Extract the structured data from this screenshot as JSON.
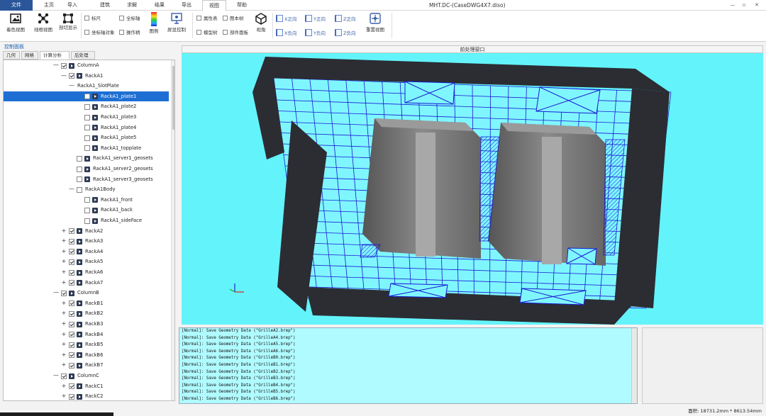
{
  "menubar": {
    "file": "文件",
    "items": [
      "主页",
      "导入",
      "建筑",
      "求解",
      "结果",
      "导出",
      "视图",
      "帮助"
    ],
    "active": "视图",
    "window_title": "MHT.DC-(CaseDWG4X7.diso)",
    "controls": {
      "minimize": "—",
      "restore": "▫",
      "close": "✕"
    }
  },
  "ribbon": {
    "view_btn1": "着色视图",
    "view_btn2": "线框视图",
    "view_btn3": "剖切显示",
    "chk_ruler": "标尺",
    "chk_global_axis": "全标轴",
    "chk_axis_object": "坐标轴对象",
    "chk_handle": "操作柄",
    "legend": "图例",
    "screen_ctrl": "屏显控制",
    "chk_property": "属性表",
    "chk_panel": "图本树",
    "chk_model_tree": "模型树",
    "chk_component": "部件面板",
    "perspective": "视角",
    "xpos": "X正向",
    "ypos": "Y正向",
    "zpos": "Z正向",
    "xneg": "X负向",
    "yneg": "Y负向",
    "zneg": "Z负向",
    "reset": "重置视图"
  },
  "panel": {
    "title": "控制面板",
    "tabs": [
      "几何",
      "网格",
      "计算分析",
      "后处理"
    ],
    "active_tab": "计算分析"
  },
  "tree": [
    {
      "label": "ColumnA",
      "indent": 0,
      "exp": "minus",
      "chk": true
    },
    {
      "label": "RackA1",
      "indent": 1,
      "exp": "minus",
      "chk": true
    },
    {
      "label": "RackA1_SlotPlate",
      "indent": 2,
      "exp": "minus",
      "chk": null
    },
    {
      "label": "RackA1_plate1",
      "indent": 3,
      "chk": false,
      "selected": true
    },
    {
      "label": "RackA1_plate2",
      "indent": 3,
      "chk": false
    },
    {
      "label": "RackA1_plate3",
      "indent": 3,
      "chk": false
    },
    {
      "label": "RackA1_plate4",
      "indent": 3,
      "chk": false
    },
    {
      "label": "RackA1_plate5",
      "indent": 3,
      "chk": false
    },
    {
      "label": "RackA1_topplate",
      "indent": 3,
      "chk": false
    },
    {
      "label": "RackA1_server1_geosets",
      "indent": 2,
      "chk": false
    },
    {
      "label": "RackA1_server2_geosets",
      "indent": 2,
      "chk": false
    },
    {
      "label": "RackA1_server3_geosets",
      "indent": 2,
      "chk": false
    },
    {
      "label": "RackA1Body",
      "indent": 2,
      "exp": "minus",
      "chk": false,
      "noicon": true
    },
    {
      "label": "RackA1_front",
      "indent": 3,
      "chk": false
    },
    {
      "label": "RackA1_back",
      "indent": 3,
      "chk": false
    },
    {
      "label": "RackA1_sideFace",
      "indent": 3,
      "chk": false
    },
    {
      "label": "RackA2",
      "indent": 1,
      "exp": "plus",
      "chk": true
    },
    {
      "label": "RackA3",
      "indent": 1,
      "exp": "plus",
      "chk": true
    },
    {
      "label": "RackA4",
      "indent": 1,
      "exp": "plus",
      "chk": true
    },
    {
      "label": "RackA5",
      "indent": 1,
      "exp": "plus",
      "chk": true
    },
    {
      "label": "RackA6",
      "indent": 1,
      "exp": "plus",
      "chk": true
    },
    {
      "label": "RackA7",
      "indent": 1,
      "exp": "plus",
      "chk": true
    },
    {
      "label": "ColumnB",
      "indent": 0,
      "exp": "minus",
      "chk": true
    },
    {
      "label": "RackB1",
      "indent": 1,
      "exp": "plus",
      "chk": true
    },
    {
      "label": "RackB2",
      "indent": 1,
      "exp": "plus",
      "chk": true
    },
    {
      "label": "RackB3",
      "indent": 1,
      "exp": "plus",
      "chk": true
    },
    {
      "label": "RackB4",
      "indent": 1,
      "exp": "plus",
      "chk": true
    },
    {
      "label": "RackB5",
      "indent": 1,
      "exp": "plus",
      "chk": true
    },
    {
      "label": "RackB6",
      "indent": 1,
      "exp": "plus",
      "chk": true
    },
    {
      "label": "RackB7",
      "indent": 1,
      "exp": "plus",
      "chk": true
    },
    {
      "label": "ColumnC",
      "indent": 0,
      "exp": "minus",
      "chk": true
    },
    {
      "label": "RackC1",
      "indent": 1,
      "exp": "plus",
      "chk": true
    },
    {
      "label": "RackC2",
      "indent": 1,
      "exp": "plus",
      "chk": true
    }
  ],
  "viewport": {
    "title": "前处理窗口"
  },
  "console": [
    "[Normal]: Save Geometry Data (\"GrilleA2.brep\")",
    "[Normal]: Save Geometry Data (\"GrilleA4.brep\")",
    "[Normal]: Save Geometry Data (\"GrilleA5.brep\")",
    "[Normal]: Save Geometry Data (\"GrilleA6.brep\")",
    "[Normal]: Save Geometry Data (\"GrilleB0.brep\")",
    "[Normal]: Save Geometry Data (\"GrilleB1.brep\")",
    "[Normal]: Save Geometry Data (\"GrilleB2.brep\")",
    "[Normal]: Save Geometry Data (\"GrilleB3.brep\")",
    "[Normal]: Save Geometry Data (\"GrilleB4.brep\")",
    "[Normal]: Save Geometry Data (\"GrilleB5.brep\")",
    "[Normal]: Save Geometry Data (\"GrilleB6.brep\")"
  ],
  "status": {
    "text": "面积: 18731.2mm * 8613.54mm"
  },
  "colors": {
    "viewport_bg": "#63f3fb",
    "grid_line": "#1a1ad6",
    "wall": "#2b2d33",
    "selection": "#1e6fd4",
    "console_bg": "#b0fbff"
  }
}
